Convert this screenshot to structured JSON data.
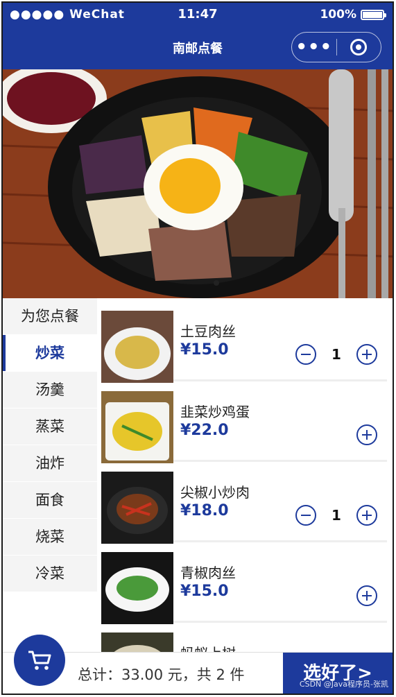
{
  "status_bar": {
    "signal": "●●●●● WeChat",
    "time": "11:47",
    "battery": "100%"
  },
  "nav": {
    "title": "南邮点餐",
    "menu_icon": "more-dots-icon",
    "close_icon": "target-icon"
  },
  "banner": {
    "image": "bibimbap-banner"
  },
  "sidebar": {
    "items": [
      {
        "label": "为您点餐",
        "active": false
      },
      {
        "label": "炒菜",
        "active": true
      },
      {
        "label": "汤羹",
        "active": false
      },
      {
        "label": "蒸菜",
        "active": false
      },
      {
        "label": "油炸",
        "active": false
      },
      {
        "label": "面食",
        "active": false
      },
      {
        "label": "烧菜",
        "active": false
      },
      {
        "label": "冷菜",
        "active": false
      }
    ]
  },
  "dishes": [
    {
      "name": "土豆肉丝",
      "price": "¥15.0",
      "qty": "1"
    },
    {
      "name": "韭菜炒鸡蛋",
      "price": "¥22.0",
      "qty": ""
    },
    {
      "name": "尖椒小炒肉",
      "price": "¥18.0",
      "qty": "1"
    },
    {
      "name": "青椒肉丝",
      "price": "¥15.0",
      "qty": ""
    },
    {
      "name": "蚂蚁上树",
      "price": "",
      "qty": ""
    }
  ],
  "bottom": {
    "total": "总计：33.00 元，共 2 件",
    "checkout": "选好了>",
    "cart_icon": "cart-icon"
  },
  "watermark": "CSDN @Java程序员-张凯",
  "colors": {
    "brand": "#1d3a9c"
  }
}
